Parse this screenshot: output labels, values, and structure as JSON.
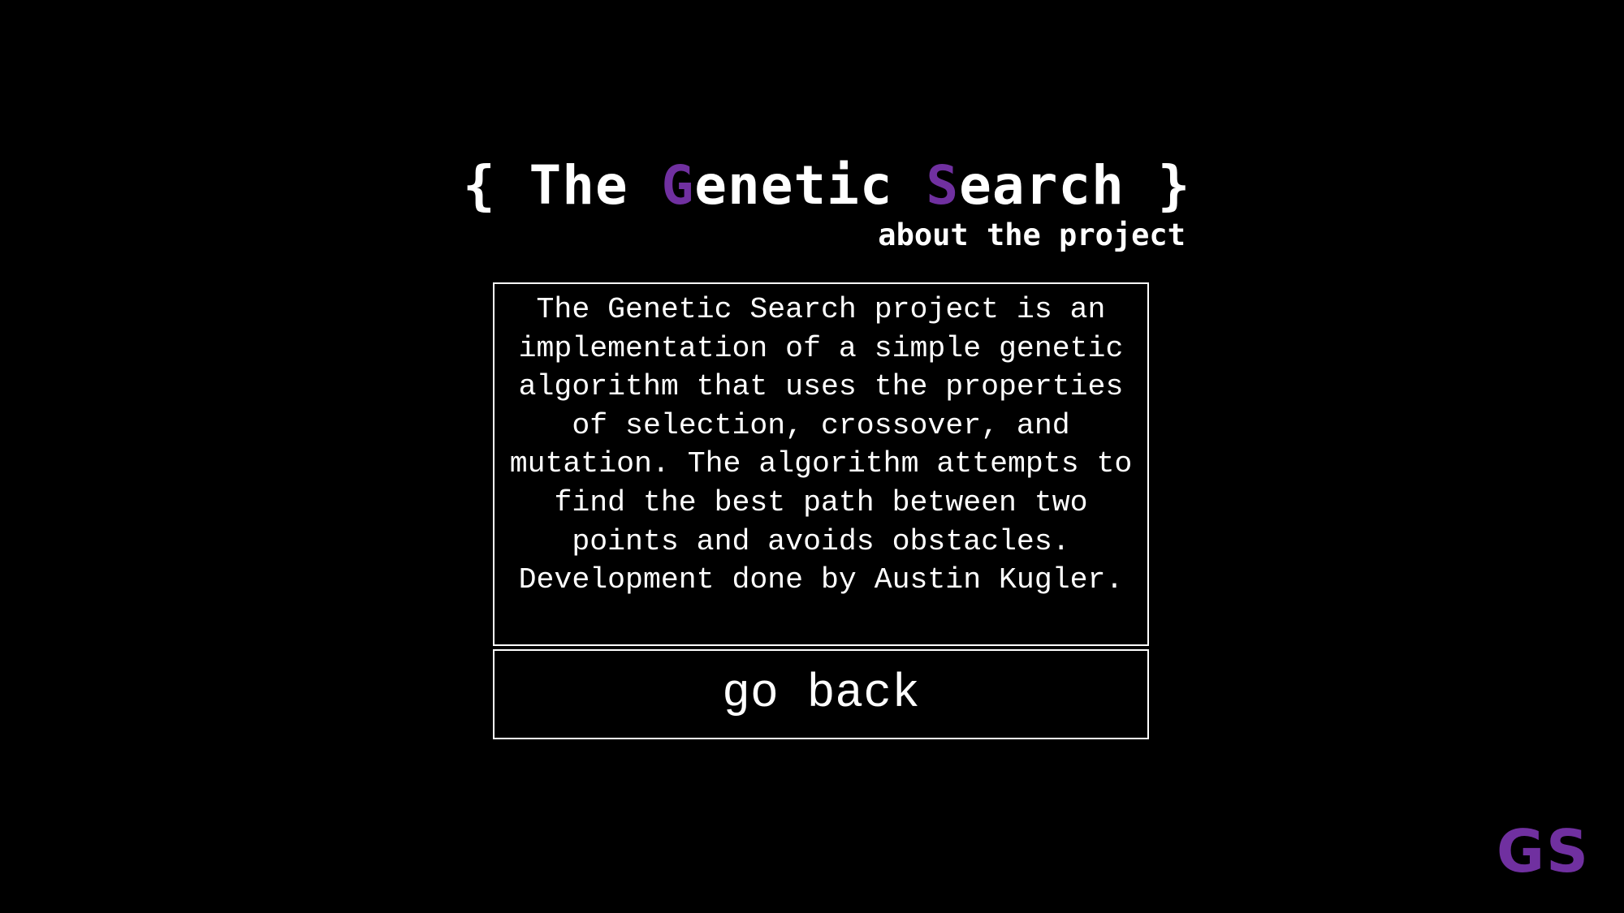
{
  "header": {
    "open_brace": "{",
    "title_the": "The",
    "title_g": "G",
    "title_enetic": "enetic",
    "title_s": "S",
    "title_earch": "earch",
    "close_brace": "}",
    "subtitle": "about the project"
  },
  "about": {
    "text": "The Genetic Search project is an implementation of a simple genetic algorithm that uses the properties of selection, crossover, and mutation. The algorithm attempts to find the best path between two points and avoids obstacles. Development done by Austin Kugler."
  },
  "actions": {
    "back_label": "go back"
  },
  "logo": {
    "text": "GS"
  },
  "colors": {
    "background": "#000000",
    "foreground": "#ffffff",
    "accent": "#7030a0"
  }
}
